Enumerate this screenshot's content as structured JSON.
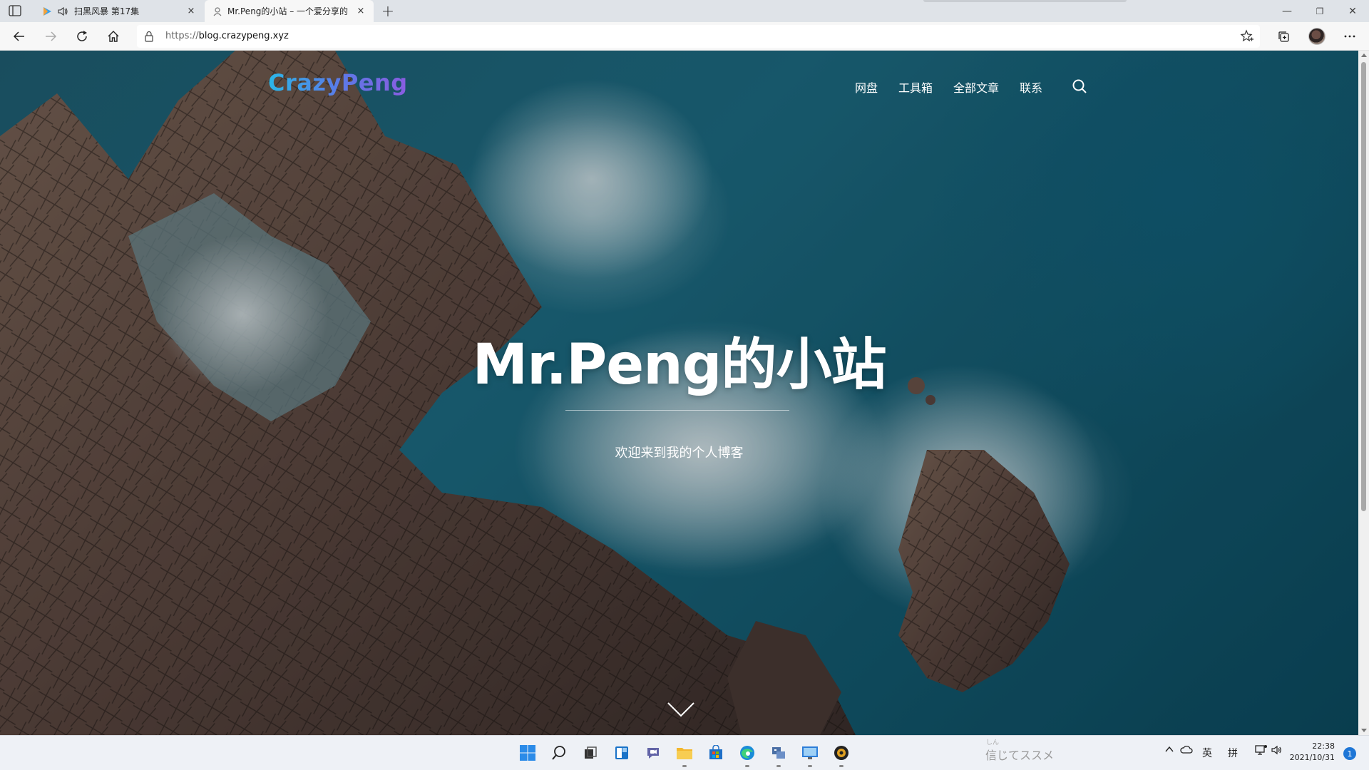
{
  "browser": {
    "tabs": [
      {
        "title": "扫黑风暴 第17集",
        "close": "×",
        "playing_audio": true
      },
      {
        "title": "Mr.Peng的小站 – 一个爱分享的",
        "close": "×",
        "active": true
      }
    ],
    "new_tab": "+",
    "window": {
      "minimize": "—",
      "restore": "❐",
      "close": "✕"
    },
    "address": {
      "scheme": "https://",
      "host": "blog.crazypeng.xyz"
    }
  },
  "site": {
    "logo": "CrazyPeng",
    "nav": [
      "网盘",
      "工具箱",
      "全部文章",
      "联系"
    ],
    "hero": {
      "title": "Mr.Peng的小站",
      "subtitle": "欢迎来到我的个人博客"
    }
  },
  "taskbar": {
    "ime_ruby": "しん",
    "ime_text": "信じてススメ",
    "tray": {
      "lang1": "英",
      "lang2": "拼"
    },
    "clock": {
      "time": "22:38",
      "date": "2021/10/31"
    },
    "notifications": "1"
  },
  "colors": {
    "logo_gradient_start": "#2bb7e8",
    "logo_gradient_end": "#8a5ce0",
    "taskbar_bg": "#eef1f6",
    "ocean": "#1d6b82"
  }
}
